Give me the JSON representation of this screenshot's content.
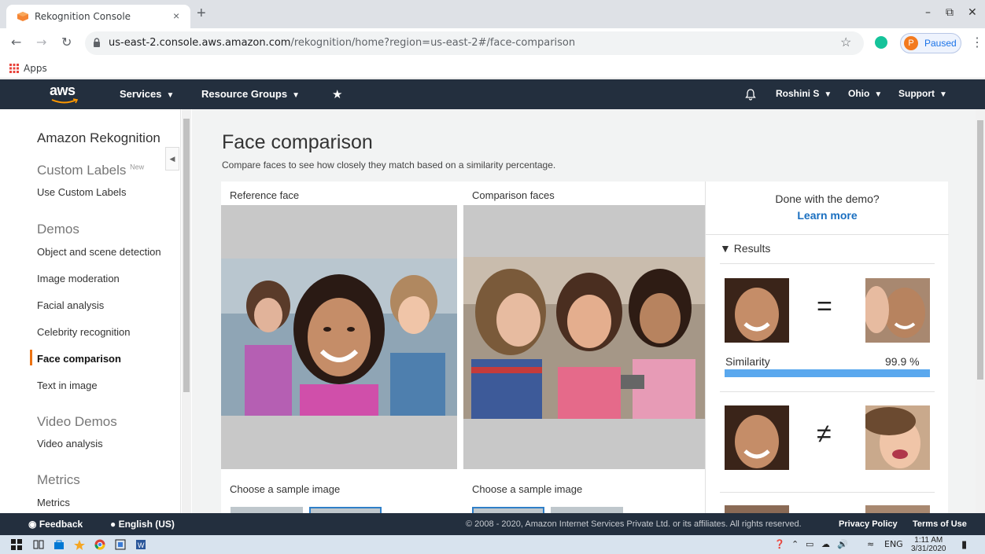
{
  "browser": {
    "tab_title": "Rekognition Console",
    "close_glyph": "×",
    "new_tab_glyph": "+",
    "url_host": "us-east-2.console.aws.amazon.com",
    "url_path": "/rekognition/home?region=us-east-2#/face-comparison",
    "profile_initial": "P",
    "profile_status": "Paused",
    "bookmarks": {
      "apps_label": "Apps"
    }
  },
  "aws_nav": {
    "logo_text": "aws",
    "services_label": "Services",
    "resource_groups_label": "Resource Groups",
    "user_label": "Roshini S",
    "region_label": "Ohio",
    "support_label": "Support"
  },
  "sidebar": {
    "title": "Amazon Rekognition",
    "custom_labels_heading": "Custom Labels",
    "new_badge": "New",
    "use_custom_labels": "Use Custom Labels",
    "demos_heading": "Demos",
    "demos": [
      "Object and scene detection",
      "Image moderation",
      "Facial analysis",
      "Celebrity recognition",
      "Face comparison",
      "Text in image"
    ],
    "active_item": "Face comparison",
    "video_heading": "Video Demos",
    "video_item": "Video analysis",
    "metrics_heading": "Metrics",
    "metrics_item": "Metrics"
  },
  "main": {
    "title": "Face comparison",
    "subtitle": "Compare faces to see how closely they match based on a similarity percentage.",
    "reference_label": "Reference face",
    "comparison_label": "Comparison faces",
    "choose_sample_label": "Choose a sample image"
  },
  "results": {
    "done_text": "Done with the demo?",
    "learn_more": "Learn more",
    "toggle_label": "Results",
    "matches": [
      {
        "symbol": "=",
        "similarity_label": "Similarity",
        "similarity_value": "99.9 %",
        "similarity_fraction": 0.999
      },
      {
        "symbol": "≠"
      }
    ]
  },
  "footer": {
    "feedback": "Feedback",
    "language": "English (US)",
    "copyright": "© 2008 - 2020, Amazon Internet Services Private Ltd. or its affiliates. All rights reserved.",
    "privacy": "Privacy Policy",
    "terms": "Terms of Use"
  },
  "taskbar": {
    "time": "1:11 AM",
    "date": "3/31/2020",
    "language": "ENG"
  },
  "colors": {
    "aws_nav_bg": "#232f3e",
    "aws_accent": "#ec7211",
    "link_blue": "#1a6fc0",
    "similarity_bar": "#5aa8ee"
  },
  "icons": [
    "rekognition-favicon",
    "lock-icon",
    "star-icon",
    "grammarly-icon",
    "apps-icon",
    "pin-icon",
    "bell-icon",
    "feedback-icon",
    "globe-icon"
  ]
}
